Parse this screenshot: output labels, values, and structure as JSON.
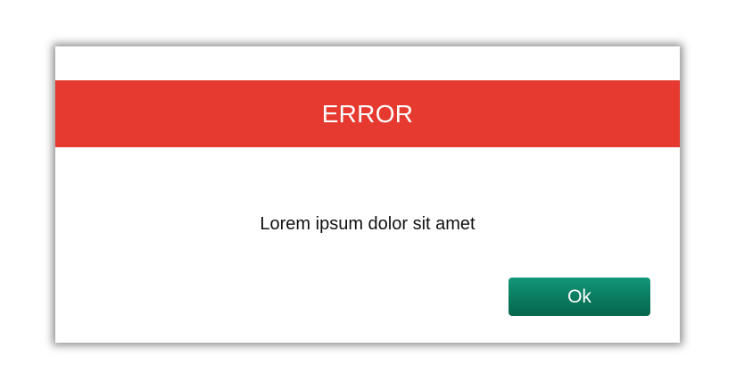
{
  "dialog": {
    "title": "ERROR",
    "message": "Lorem ipsum dolor sit amet",
    "ok_label": "Ok"
  },
  "colors": {
    "banner": "#e63a30",
    "button": "#0a7a5e",
    "text": "#111111"
  }
}
